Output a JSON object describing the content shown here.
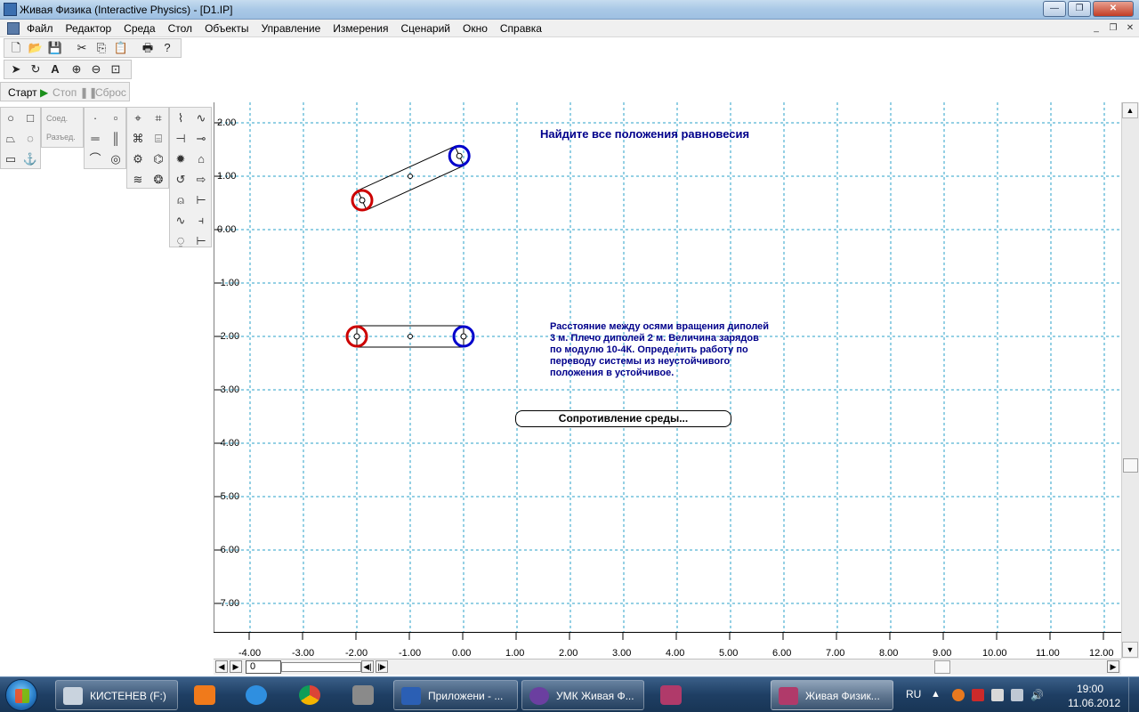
{
  "window": {
    "title": "Живая Физика (Interactive Physics) - [D1.IP]"
  },
  "menu": [
    "Файл",
    "Редактор",
    "Среда",
    "Стол",
    "Объекты",
    "Управление",
    "Измерения",
    "Сценарий",
    "Окно",
    "Справка"
  ],
  "run_controls": {
    "start": "Старт",
    "stop": "Стоп",
    "reset": "Сброс"
  },
  "palette": {
    "join": "Соед.",
    "split": "Разъед."
  },
  "canvas": {
    "heading": "Найдите все положения равновесия",
    "problem_text": [
      "Расстояние между осями вращения диполей",
      "3 м. Плечо диполей 2 м. Величина зарядов",
      "по модулю 10-4К. Определить работу по",
      "переводу системы из неустойчивого",
      "положения в устойчивое."
    ],
    "button_label": "Сопротивление среды...",
    "y_axis_labels": [
      "2.00",
      "1.00",
      "0.00",
      "-1.00",
      "-2.00",
      "-3.00",
      "-4.00",
      "-5.00",
      "-6.00",
      "-7.00"
    ],
    "x_axis_labels": [
      "-4.00",
      "-3.00",
      "-2.00",
      "-1.00",
      "0.00",
      "1.00",
      "2.00",
      "3.00",
      "4.00",
      "5.00",
      "6.00",
      "7.00",
      "8.00",
      "9.00",
      "10.00",
      "11.00",
      "12.00"
    ],
    "dipole_top": {
      "neg_x": -1.9,
      "neg_y": 0.55,
      "pos_x": -0.08,
      "pos_y": 1.38,
      "center_x": -1.0,
      "center_y": 1.0
    },
    "dipole_bottom": {
      "neg_x": -2.0,
      "neg_y": -2.0,
      "pos_x": 0.0,
      "pos_y": -2.0,
      "center_x": -1.0,
      "center_y": -2.0
    },
    "colors": {
      "grid": "#2aa0c8",
      "text": "#00008b",
      "negative": "#cc0000",
      "positive": "#0000cc"
    }
  },
  "frame": {
    "value": "0"
  },
  "taskbar": {
    "items": [
      {
        "label": "КИСТЕНЕВ (F:)"
      },
      {
        "label": "Приложени - ..."
      },
      {
        "label": "УМК Живая Ф..."
      },
      {
        "label": "Живая Физик..."
      }
    ],
    "lang": "RU",
    "time": "19:00",
    "date": "11.06.2012"
  }
}
